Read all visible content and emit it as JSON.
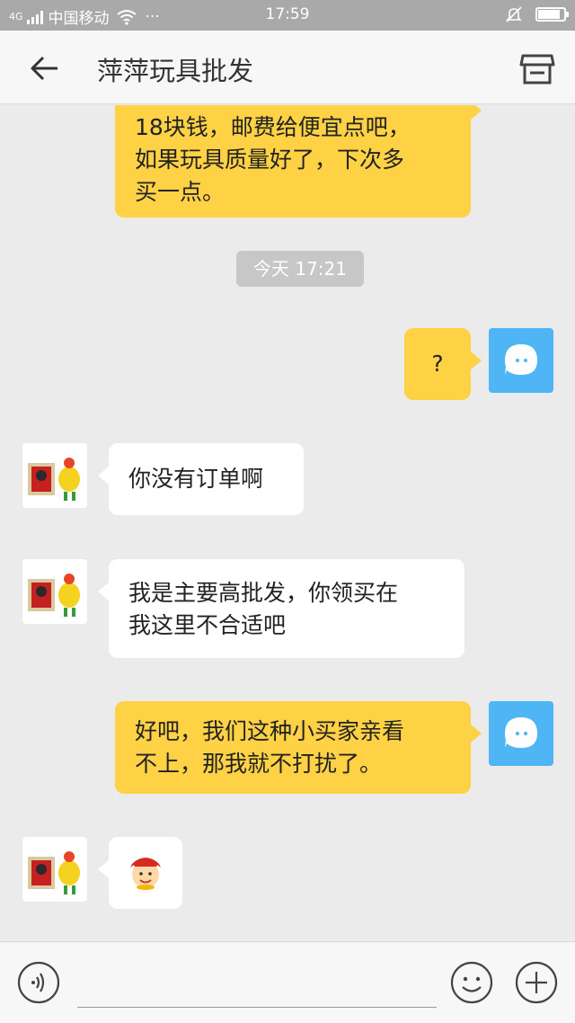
{
  "status_bar": {
    "network": "4G",
    "carrier": "中国移动",
    "dots": "···",
    "time": "17:59",
    "battery_level": 0.85
  },
  "header": {
    "title": "萍萍玩具批发",
    "back_icon": "back-arrow-icon",
    "shop_icon": "store-icon"
  },
  "chat": {
    "messages": [
      {
        "from": "me",
        "lines": [
          "18块钱，邮费给便宜点吧，",
          "如果玩具质量好了，下次多",
          "买一点。"
        ]
      },
      {
        "type": "timestamp",
        "text": "今天 17:21"
      },
      {
        "from": "me",
        "lines": [
          "?"
        ]
      },
      {
        "from": "other",
        "lines": [
          "你没有订单啊"
        ]
      },
      {
        "from": "other",
        "lines": [
          "我是主要高批发，你领买在",
          "我这里不合适吧"
        ]
      },
      {
        "from": "me",
        "lines": [
          "好吧，我们这种小买家亲看",
          "不上，那我就不打扰了。"
        ]
      },
      {
        "from": "other",
        "type": "emoji",
        "emoji_icon": "fortune-god-emoji-icon"
      }
    ]
  },
  "input_bar": {
    "placeholder": "",
    "voice_icon": "voice-icon",
    "emoji_icon": "smiley-icon",
    "plus_icon": "plus-icon"
  }
}
